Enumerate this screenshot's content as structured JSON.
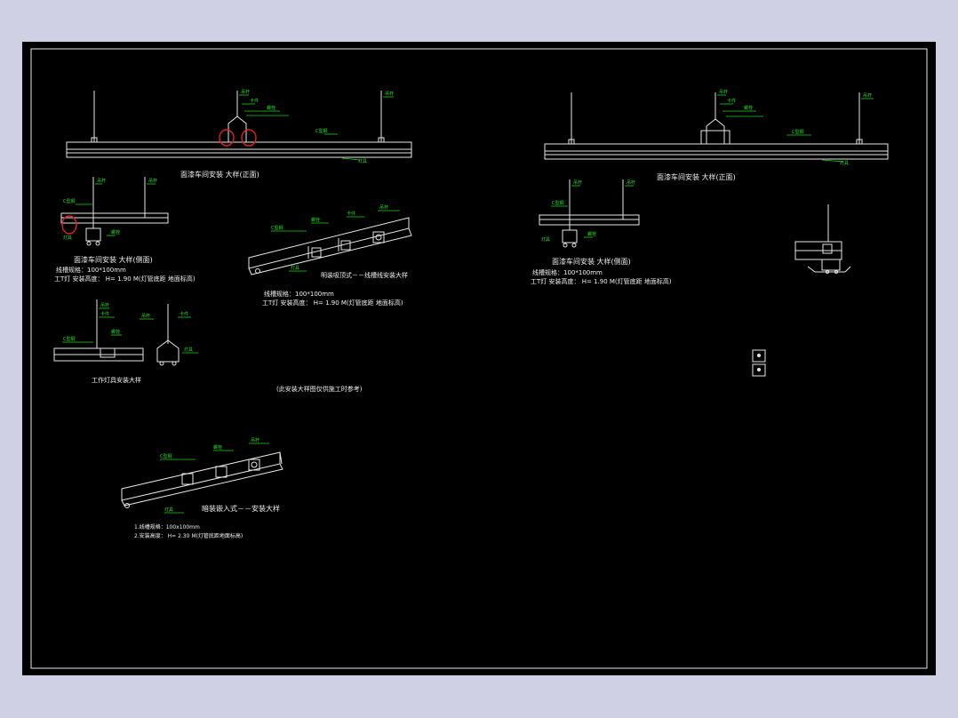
{
  "drawing": {
    "front_view_title": "面漆车间安装 大样(正面)",
    "side_view_title": "面漆车间安装 大样(侧面)",
    "tag_lamp_spec": "线槽规格：100*100mm",
    "tag_install_height": "工T灯 安装高度： H= 1.90 M(灯管底距 地面标高)",
    "tag_install_height_right": "工T灯 安装高度： H= 1.90 M(灯管底距 地面标高)",
    "tag_lamp_spec_right": "线槽规格：100*100mm",
    "oblique_title": "明装吸顶式－－线槽线安装大样",
    "oblique_spec": "线槽规格：100*100mm",
    "oblique_height": "工T灯 安装高度： H= 1.90 M(灯管底距 地面标高)",
    "work_lamp_title": "工作灯具安装大样",
    "note_reference": "(此安装大样图仅供施工时参考)",
    "recessed_title": "暗装嵌入式－－安装大样",
    "recessed_spec": "1.线槽规格：100x100mm",
    "recessed_height": "2.安装高度： H= 2.30 M(灯管底距地面标高)",
    "green_labels": {
      "rod": "吊杆",
      "clamp": "卡件",
      "bolt": "螺栓",
      "channel": "C型钢",
      "lamp": "灯具"
    }
  }
}
